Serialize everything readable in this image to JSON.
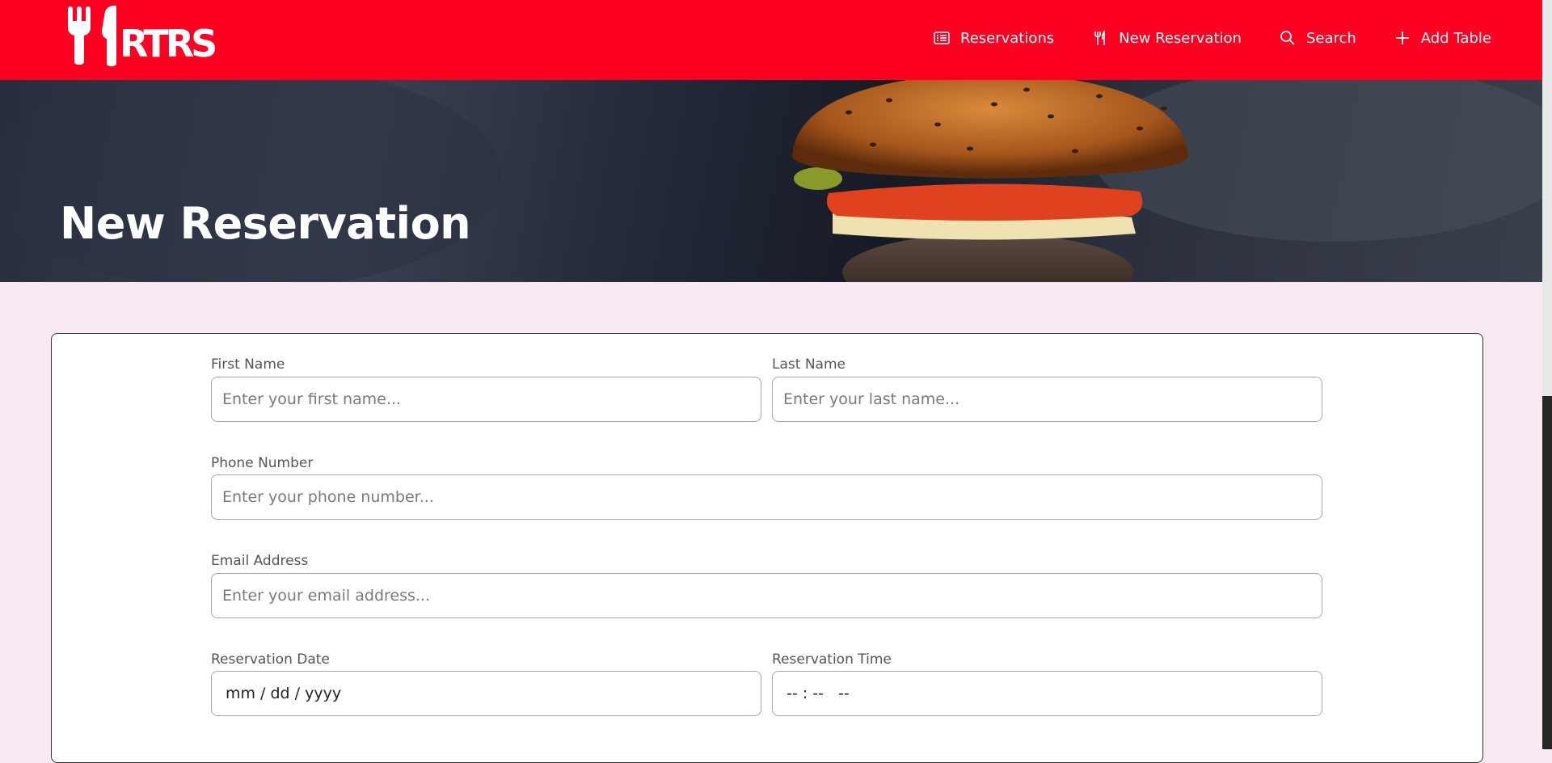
{
  "brand": {
    "logo_text": "RTRS",
    "color": "#fe0022"
  },
  "nav": {
    "items": [
      {
        "label": "Reservations",
        "icon": "list-icon"
      },
      {
        "label": "New Reservation",
        "icon": "utensils-icon"
      },
      {
        "label": "Search",
        "icon": "search-icon"
      },
      {
        "label": "Add Table",
        "icon": "plus-icon"
      }
    ]
  },
  "hero": {
    "title": "New Reservation"
  },
  "form": {
    "first_name": {
      "label": "First Name",
      "placeholder": "Enter your first name..."
    },
    "last_name": {
      "label": "Last Name",
      "placeholder": "Enter your last name..."
    },
    "phone": {
      "label": "Phone Number",
      "placeholder": "Enter your phone number..."
    },
    "email": {
      "label": "Email Address",
      "placeholder": "Enter your email address..."
    },
    "date": {
      "label": "Reservation Date",
      "value": "mm / dd / yyyy"
    },
    "time": {
      "label": "Reservation Time",
      "value": "-- : --   --"
    }
  }
}
